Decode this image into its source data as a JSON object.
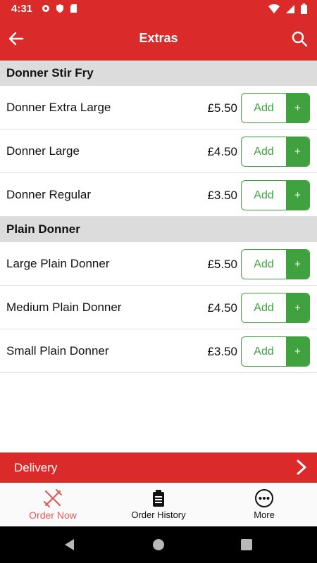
{
  "status_bar": {
    "time": "4:31"
  },
  "app_bar": {
    "title": "Extras"
  },
  "sections": [
    {
      "title": "Donner Stir Fry",
      "items": [
        {
          "name": "Donner Extra Large",
          "price": "£5.50",
          "add_label": "Add",
          "plus_label": "+"
        },
        {
          "name": "Donner Large",
          "price": "£4.50",
          "add_label": "Add",
          "plus_label": "+"
        },
        {
          "name": "Donner Regular",
          "price": "£3.50",
          "add_label": "Add",
          "plus_label": "+"
        }
      ]
    },
    {
      "title": "Plain Donner",
      "items": [
        {
          "name": "Large Plain Donner",
          "price": "£5.50",
          "add_label": "Add",
          "plus_label": "+"
        },
        {
          "name": "Medium Plain Donner",
          "price": "£4.50",
          "add_label": "Add",
          "plus_label": "+"
        },
        {
          "name": "Small Plain Donner",
          "price": "£3.50",
          "add_label": "Add",
          "plus_label": "+"
        }
      ]
    }
  ],
  "delivery_bar": {
    "label": "Delivery"
  },
  "bottom_nav": {
    "tabs": [
      {
        "label": "Order Now",
        "icon": "fork-knife-icon",
        "active": true
      },
      {
        "label": "Order History",
        "icon": "clipboard-icon",
        "active": false
      },
      {
        "label": "More",
        "icon": "more-dots-icon",
        "active": false
      }
    ]
  },
  "colors": {
    "primary_red": "#db2a2a",
    "add_green": "#3fa23f",
    "section_gray": "#dcdcdc",
    "active_tab": "#e05a5a"
  }
}
